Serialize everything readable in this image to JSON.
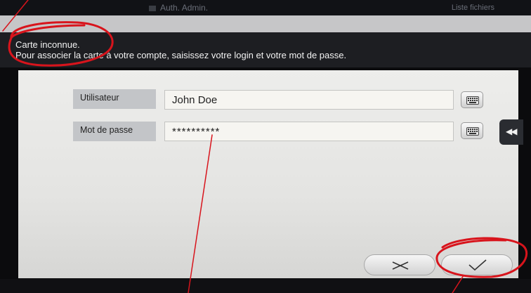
{
  "topbar": {
    "auth_label": "Auth. Admin.",
    "list_label": "Liste fichiers"
  },
  "message": {
    "line1": "Carte inconnue.",
    "line2": "Pour associer la carte à votre compte, saisissez votre login et votre mot de passe."
  },
  "form": {
    "username_label": "Utilisateur",
    "username_value": "John Doe",
    "password_label": "Mot de passe",
    "password_value": "**********"
  },
  "buttons": {
    "cancel_icon": "x-icon",
    "ok_icon": "check-icon",
    "side_tab_glyph": "◀◀"
  },
  "colors": {
    "annotation": "#d8141c",
    "panel": "#ececea",
    "dark_band": "#1d1e22"
  }
}
